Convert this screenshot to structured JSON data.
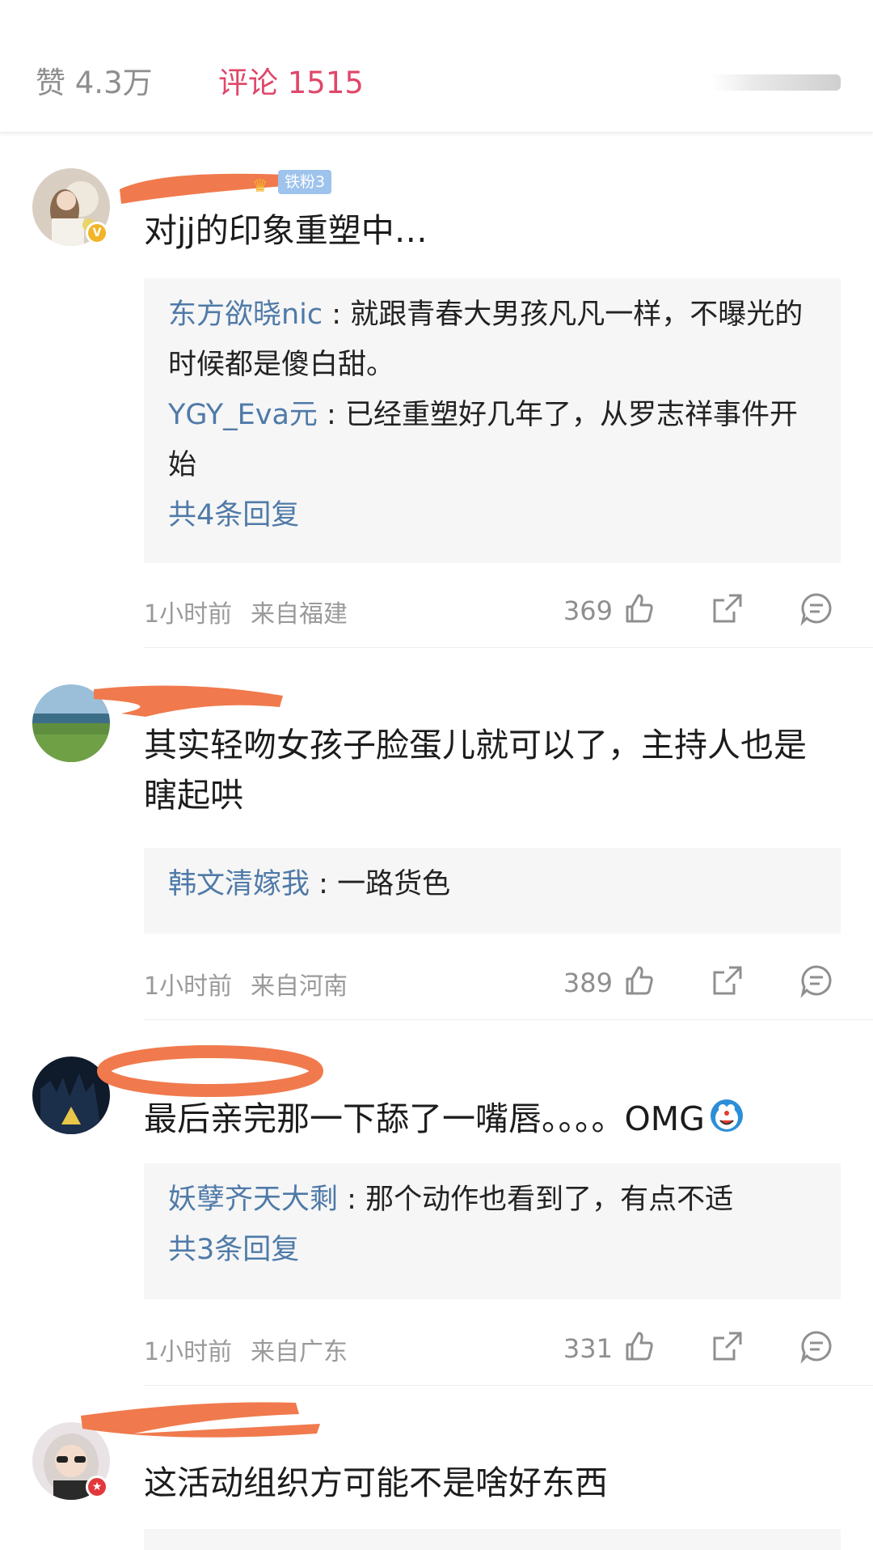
{
  "header": {
    "likes_tab": "赞 4.3万",
    "comments_tab": "评论 1515"
  },
  "comments": [
    {
      "fan_badge": "铁粉3",
      "text": "对jj的印象重塑中…",
      "replies": [
        {
          "name": "东方欲晓nic",
          "sep": " : ",
          "text": "就跟青春大男孩凡凡一样，不曝光的时候都是傻白甜。"
        },
        {
          "name": "YGY_Eva元",
          "sep": " : ",
          "text": "已经重塑好几年了，从罗志祥事件开始"
        }
      ],
      "reply_count": "共4条回复",
      "time": "1小时前",
      "location": "来自福建",
      "likes": "369"
    },
    {
      "text": "其实轻吻女孩子脸蛋儿就可以了，主持人也是瞎起哄",
      "replies": [
        {
          "name": "韩文清嫁我",
          "sep": " : ",
          "text": "一路货色"
        }
      ],
      "time": "1小时前",
      "location": "来自河南",
      "likes": "389"
    },
    {
      "text": "最后亲完那一下舔了一嘴唇。。。。OMG",
      "replies": [
        {
          "name": "妖孽齐天大剩",
          "sep": " : ",
          "text": "那个动作也看到了，有点不适"
        }
      ],
      "reply_count": "共3条回复",
      "time": "1小时前",
      "location": "来自广东",
      "likes": "331"
    },
    {
      "text": "这活动组织方可能不是啥好东西"
    }
  ],
  "icons": {
    "like": "thumbs-up-icon",
    "share": "share-icon",
    "reply": "comment-icon"
  },
  "colors": {
    "accent": "#e0476a",
    "reply_name": "#4f7aa8",
    "redaction": "#f07a4d"
  }
}
